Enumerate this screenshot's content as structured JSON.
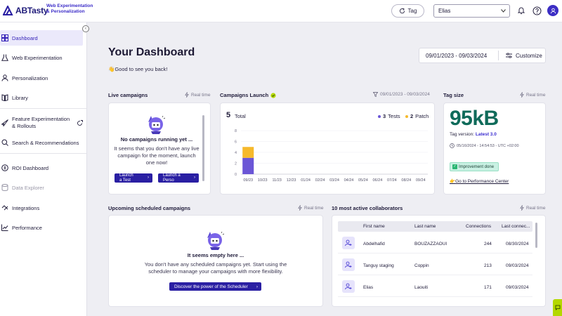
{
  "app": {
    "logo_text": "ABTasty",
    "logo_sub_line1": "Web Experimentation",
    "logo_sub_line2": "& Personalization"
  },
  "topbar": {
    "tag_button_label": "Tag",
    "account_select_value": "Elias",
    "icons": [
      "refresh-icon",
      "bell-icon",
      "help-icon",
      "user-icon"
    ]
  },
  "sidebar": {
    "items": [
      {
        "label": "Dashboard",
        "icon": "dashboard-icon",
        "active": true
      },
      {
        "label": "Web Experimentation",
        "icon": "flask-icon"
      },
      {
        "label": "Personalization",
        "icon": "person-icon"
      },
      {
        "label": "Library",
        "icon": "book-icon"
      },
      {
        "label": "Feature Experimentation & Rollouts",
        "icon": "rocket-icon"
      },
      {
        "label": "Search & Recommendations",
        "icon": "search-icon"
      },
      {
        "label": "ROI Dashboard",
        "icon": "roi-icon"
      },
      {
        "label": "Data Explorer",
        "icon": "database-icon",
        "disabled": true
      },
      {
        "label": "Integrations",
        "icon": "integrations-icon"
      },
      {
        "label": "Performance",
        "icon": "performance-icon"
      }
    ]
  },
  "header": {
    "title": "Your Dashboard",
    "greeting": "Good to see you back!",
    "date_range": "09/01/2023 - 09/03/2024",
    "customize_label": "Customize"
  },
  "live_campaigns": {
    "title": "Live campaigns",
    "realtime_label": "Real time",
    "empty_title": "No campaigns running yet ...",
    "empty_text": "It seems that you don't have any live campaign for the moment, launch one now!",
    "launch_test_line1": "Launch",
    "launch_test_line2": "a Test",
    "launch_perso_line1": "Launch a",
    "launch_perso_line2": "Perso"
  },
  "campaigns_launch": {
    "title": "Campaigns Launch",
    "date_range": "09/01/2023 - 09/03/2024",
    "total_count": "5",
    "total_label": "Total",
    "tests_count": "3",
    "tests_label": "Tests",
    "patch_count": "2",
    "patch_label": "Patch",
    "colors": {
      "tests": "#6b56d6",
      "patch": "#f6b92b"
    }
  },
  "chart_data": {
    "type": "bar",
    "categories": [
      "09/23",
      "10/23",
      "11/23",
      "12/23",
      "01/24",
      "02/24",
      "03/24",
      "04/24",
      "05/24",
      "06/24",
      "07/24",
      "08/24",
      "09/24"
    ],
    "series": [
      {
        "name": "Tests",
        "values": [
          3,
          0,
          0,
          0,
          0,
          0,
          0,
          0,
          0,
          0,
          0,
          0,
          0
        ]
      },
      {
        "name": "Patch",
        "values": [
          2,
          0,
          0,
          0,
          0,
          0,
          0,
          0,
          0,
          0,
          0,
          0,
          0
        ]
      }
    ],
    "stacked": true,
    "yticks": [
      "0",
      "2",
      "4",
      "6",
      "8"
    ],
    "ylim": [
      0,
      8
    ],
    "title": "",
    "xlabel": "",
    "ylabel": "",
    "grid": true
  },
  "tag_size": {
    "title": "Tag size",
    "realtime_label": "Real time",
    "value": "95kB",
    "version_label": "Tag version:",
    "version_value": "Latest 3.0",
    "timestamp": "05/16/2024 - 14:54:53 - UTC +02:00",
    "badge_text": "Improvement done",
    "perf_link": "Go to Performance Center"
  },
  "upcoming": {
    "title": "Upcoming scheduled campaigns",
    "realtime_label": "Real time",
    "empty_title": "It seems empty here ...",
    "empty_text": "You don't have any scheduled campaigns yet. Start using the scheduler to manage your campaigns with more flexibility.",
    "cta_label": "Discover the power of the Scheduler"
  },
  "collaborators": {
    "title": "10 most active collaborators",
    "realtime_label": "Real time",
    "columns": [
      "First name",
      "Last name",
      "Connections",
      "Last connec..."
    ],
    "rows": [
      {
        "first": "Abdelhafid",
        "last": "BOUZAZZAOUI",
        "connections": "244",
        "last_connection": "08/30/2024"
      },
      {
        "first": "Tanguy staging",
        "last": "Coppin",
        "connections": "213",
        "last_connection": "09/03/2024"
      },
      {
        "first": "Elias",
        "last": "Laouiti",
        "connections": "171",
        "last_connection": "09/03/2024"
      }
    ]
  }
}
